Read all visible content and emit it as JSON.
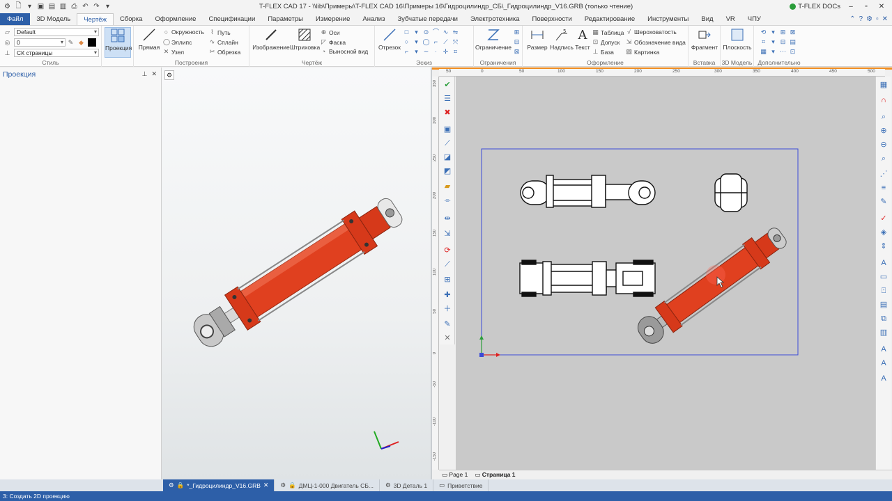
{
  "window": {
    "title": "T-FLEX CAD 17 - \\\\lib\\Примеры\\T-FLEX CAD 16\\Примеры 16\\Гидроцилиндр_СБ\\_Гидроцилиндр_V16.GRB (только чтение)",
    "docs_label": "T-FLEX DOCs"
  },
  "tabs": [
    {
      "label": "Файл"
    },
    {
      "label": "3D Модель"
    },
    {
      "label": "Чертёж"
    },
    {
      "label": "Сборка"
    },
    {
      "label": "Оформление"
    },
    {
      "label": "Спецификации"
    },
    {
      "label": "Параметры"
    },
    {
      "label": "Измерение"
    },
    {
      "label": "Анализ"
    },
    {
      "label": "Зубчатые передачи"
    },
    {
      "label": "Электротехника"
    },
    {
      "label": "Поверхности"
    },
    {
      "label": "Редактирование"
    },
    {
      "label": "Инструменты"
    },
    {
      "label": "Вид"
    },
    {
      "label": "VR"
    },
    {
      "label": "ЧПУ"
    }
  ],
  "ribbon": {
    "style": {
      "layer": "Default",
      "level": "0",
      "cs": "СК страницы",
      "label": "Стиль"
    },
    "projection": {
      "label": "Проекция"
    },
    "build": {
      "line": "Прямая",
      "circle": "Окружность",
      "ellipse": "Эллипс",
      "node": "Узел",
      "path": "Путь",
      "spline": "Сплайн",
      "trim": "Обрезка",
      "label": "Построения"
    },
    "drawing": {
      "image": "Изображение",
      "hatch": "Штриховка",
      "axes": "Оси",
      "chamfer": "Фаска",
      "callout": "Выносной вид",
      "label": "Чертёж"
    },
    "sketch": {
      "segment": "Отрезок",
      "label": "Эскиз"
    },
    "constraints": {
      "constraint": "Ограничение",
      "label": "Ограничения"
    },
    "annot": {
      "dimension": "Размер",
      "inscription": "Надпись",
      "text": "Текст",
      "table": "Таблица",
      "tolerance": "Допуск",
      "base": "База",
      "roughness": "Шероховатость",
      "view_mark": "Обозначение вида",
      "picture": "Картинка",
      "label": "Оформление"
    },
    "insert": {
      "fragment": "Фрагмент",
      "label": "Вставка"
    },
    "model3d": {
      "plane": "Плоскость",
      "label": "3D Модель"
    },
    "extra": {
      "label": "Дополнительно"
    }
  },
  "left_panel": {
    "title": "Проекция"
  },
  "ruler": {
    "top": [
      "50",
      "0",
      "50",
      "100",
      "150",
      "200",
      "250",
      "300",
      "350",
      "400",
      "450",
      "500"
    ],
    "left": [
      "350",
      "300",
      "250",
      "200",
      "150",
      "100",
      "50",
      "0",
      "-50",
      "-100",
      "-150"
    ]
  },
  "pages": [
    {
      "label": "Page 1"
    },
    {
      "label": "Страница 1"
    }
  ],
  "doc_tabs": [
    {
      "label": "*_Гидроцилиндр_V16.GRB"
    },
    {
      "label": "ДМЦ-1-000 Двигатель СБ..."
    },
    {
      "label": "3D Деталь 1"
    },
    {
      "label": "Приветствие"
    }
  ],
  "status": {
    "text": "3: Создать 2D проекцию"
  },
  "colors": {
    "accent": "#2d5fa8",
    "cylinder": "#e0401f",
    "page_border": "#3b4bd6"
  }
}
